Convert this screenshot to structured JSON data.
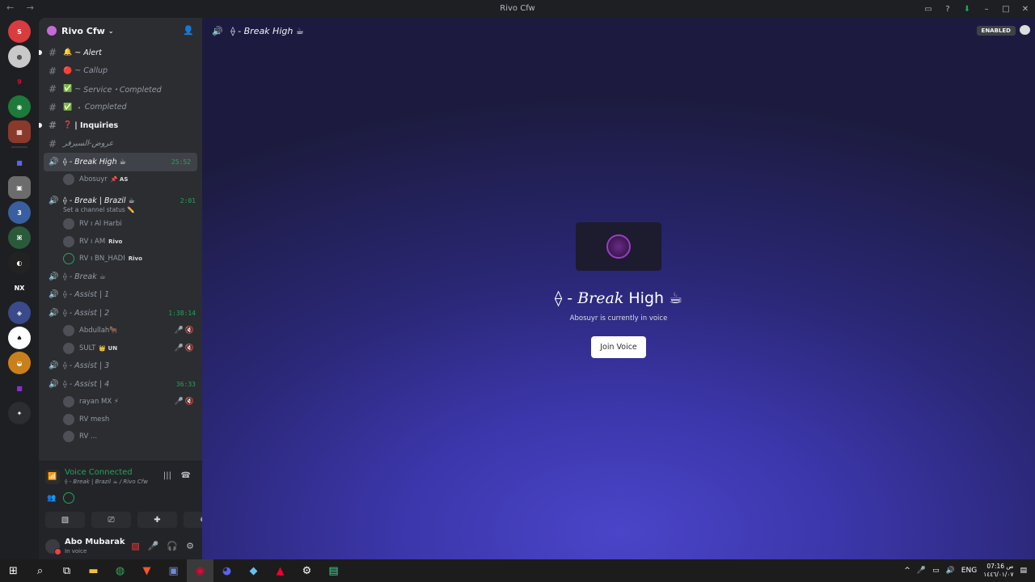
{
  "window": {
    "title": "Rivo Cfw"
  },
  "server": {
    "name": "Rivo Cfw"
  },
  "channels": [
    {
      "type": "text",
      "name": "Alert",
      "prefix": "~",
      "emoji": "🔔",
      "unread": true,
      "bold": false
    },
    {
      "type": "text",
      "name": "Callup",
      "prefix": "~",
      "emoji": "🔴"
    },
    {
      "type": "text",
      "name": "Service・Completed",
      "prefix": "~",
      "emoji": "✅"
    },
    {
      "type": "text",
      "name": "Completed",
      "prefix": "・",
      "emoji": "✅"
    },
    {
      "type": "text",
      "name": "Inquiries",
      "prefix": "|",
      "emoji": "❓",
      "unread": true,
      "bold": true
    },
    {
      "type": "text",
      "name": "عروض-السيرفر",
      "prefix": "",
      "emoji": ""
    }
  ],
  "voice_channels": {
    "break_high": {
      "name": "⟠ - Break High ☕",
      "timer": "25:52",
      "members": [
        {
          "name": "Abosuyr",
          "tag": "📌 AS"
        }
      ]
    },
    "break_brazil": {
      "name": "⟠ - Break | Brazil ☕",
      "timer": "2:01",
      "status": "Set a channel status ✏️",
      "members": [
        {
          "name": "RV ı Al Harbi",
          "tag": ""
        },
        {
          "name": "RV ı AM",
          "tag": "Rivo"
        },
        {
          "name": "RV ı BN_HADI",
          "tag": "Rivo"
        }
      ]
    },
    "break": {
      "name": "⟠ - Break ☕"
    },
    "assist1": {
      "name": "⟠ - Assist | 1"
    },
    "assist2": {
      "name": "⟠ - Assist | 2",
      "timer": "1:38:14",
      "members": [
        {
          "name": "Abdullah🐂",
          "tag": ""
        },
        {
          "name": "SULT",
          "tag": "👑 UN"
        }
      ]
    },
    "assist3": {
      "name": "⟠ - Assist | 3"
    },
    "assist4": {
      "name": "⟠ - Assist | 4",
      "timer": "36:33",
      "members": [
        {
          "name": "rayan MX ⚡",
          "tag": ""
        },
        {
          "name": "RV mesh",
          "tag": ""
        },
        {
          "name": "RV ...",
          "tag": ""
        }
      ]
    }
  },
  "voice_panel": {
    "title": "Voice Connected",
    "subtitle": "⟠ - Break | Brazil ☕ / Rivo Cfw"
  },
  "user": {
    "name": "Abo Mubarak",
    "status": "In voice"
  },
  "main": {
    "header": "⟠ - Break High ☕",
    "badge": "ENABLED",
    "stage_title_prefix": "⟠ - ",
    "stage_title_italic": "Break",
    "stage_title_suffix": " High ☕",
    "stage_sub": "Abosuyr is currently in voice",
    "join_label": "Join Voice"
  },
  "taskbar": {
    "lang": "ENG",
    "time": "07:16 ص",
    "date": "١٤٤٦/٠١/٠٧"
  }
}
